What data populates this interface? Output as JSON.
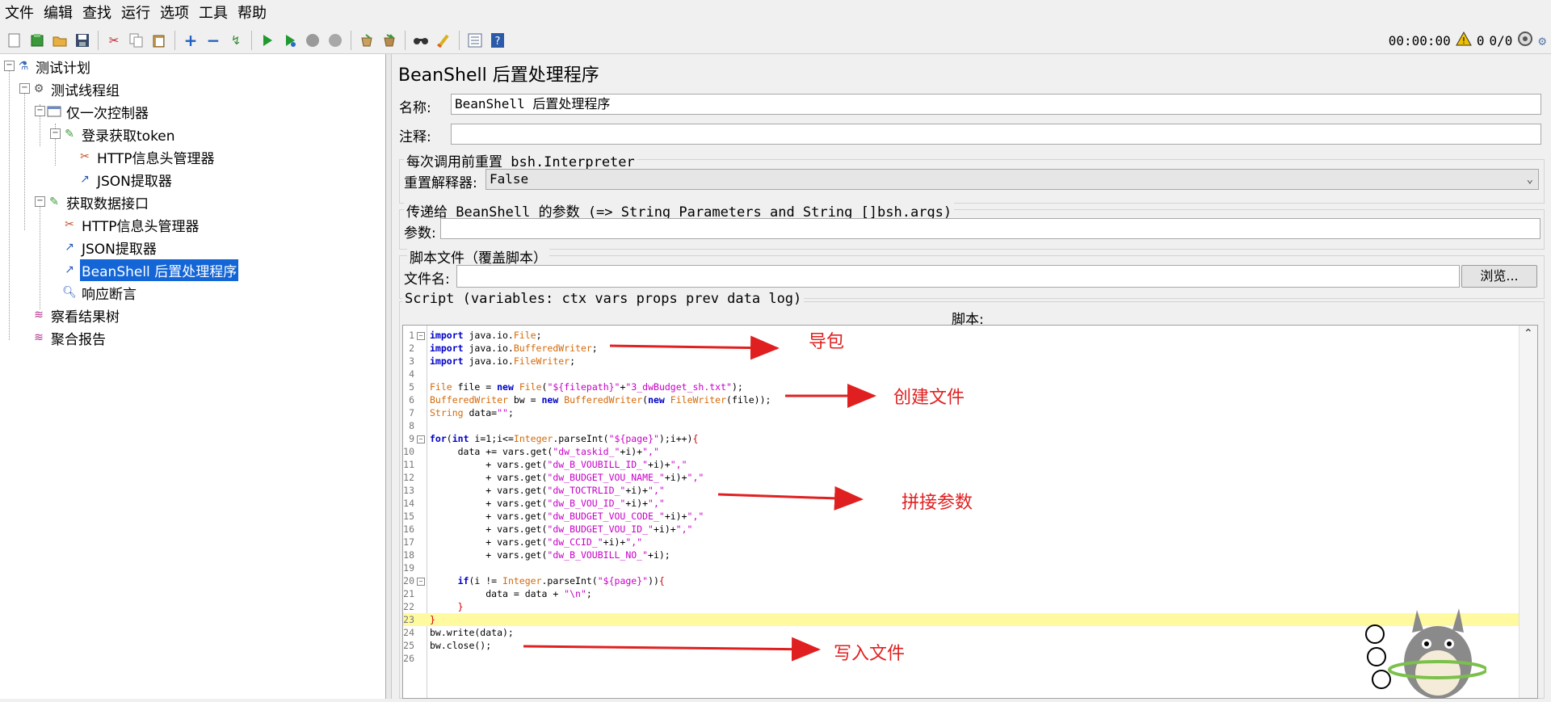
{
  "menu": [
    "文件",
    "编辑",
    "查找",
    "运行",
    "选项",
    "工具",
    "帮助"
  ],
  "toolbar": {
    "icons": [
      "new-file-icon",
      "templates-icon",
      "open-folder-icon",
      "save-icon",
      "cut-icon",
      "copy-icon",
      "paste-icon",
      "expand-icon",
      "collapse-icon",
      "toggle-icon",
      "start-icon",
      "start-no-pause-icon",
      "stop-icon",
      "shutdown-icon",
      "clear-icon",
      "clear-all-icon",
      "search-icon",
      "reset-search-icon",
      "function-helper-icon",
      "help-icon"
    ],
    "timer": "00:00:00",
    "warning_count": "0",
    "threads": "0/0"
  },
  "tree": [
    {
      "label": "测试计划",
      "icon": "test-plan-icon"
    },
    {
      "label": "测试线程组",
      "icon": "thread-group-icon"
    },
    {
      "label": "仅一次控制器",
      "icon": "controller-icon"
    },
    {
      "label": "登录获取token",
      "icon": "sampler-icon"
    },
    {
      "label": "HTTP信息头管理器",
      "icon": "header-manager-icon"
    },
    {
      "label": "JSON提取器",
      "icon": "extractor-icon"
    },
    {
      "label": "获取数据接口",
      "icon": "sampler-icon"
    },
    {
      "label": "HTTP信息头管理器",
      "icon": "header-manager-icon"
    },
    {
      "label": "JSON提取器",
      "icon": "extractor-icon"
    },
    {
      "label": "BeanShell 后置处理程序",
      "icon": "postprocessor-icon"
    },
    {
      "label": "响应断言",
      "icon": "assertion-icon"
    },
    {
      "label": "察看结果树",
      "icon": "listener-icon"
    },
    {
      "label": "聚合报告",
      "icon": "listener-icon"
    }
  ],
  "panel": {
    "title": "BeanShell 后置处理程序",
    "name_label": "名称:",
    "name_value": "BeanShell 后置处理程序",
    "comment_label": "注释:",
    "comment_value": "",
    "reset_group_title": "每次调用前重置 bsh.Interpreter",
    "reset_label": "重置解释器:",
    "reset_value": "False",
    "params_group_title": "传递给 BeanShell 的参数 (=> String Parameters and String []bsh.args)",
    "params_label": "参数:",
    "params_value": "",
    "file_group_title": "脚本文件（覆盖脚本）",
    "file_label": "文件名:",
    "file_value": "",
    "browse_label": "浏览...",
    "script_group_title": "Script (variables: ctx vars props prev data log)",
    "script_label": "脚本:"
  },
  "code": [
    "import java.io.File;",
    "import java.io.BufferedWriter;",
    "import java.io.FileWriter;",
    "",
    "File file = new File(\"${filepath}\"+\"3_dwBudget_sh.txt\");",
    "BufferedWriter bw = new BufferedWriter(new FileWriter(file));",
    "String data=\"\";",
    "",
    "for(int i=1;i<=Integer.parseInt(\"${page}\");i++){",
    "     data += vars.get(\"dw_taskid_\"+i)+\",\"",
    "          + vars.get(\"dw_B_VOUBILL_ID_\"+i)+\",\"",
    "          + vars.get(\"dw_BUDGET_VOU_NAME_\"+i)+\",\"",
    "          + vars.get(\"dw_TOCTRLID_\"+i)+\",\"",
    "          + vars.get(\"dw_B_VOU_ID_\"+i)+\",\"",
    "          + vars.get(\"dw_BUDGET_VOU_CODE_\"+i)+\",\"",
    "          + vars.get(\"dw_BUDGET_VOU_ID_\"+i)+\",\"",
    "          + vars.get(\"dw_CCID_\"+i)+\",\"",
    "          + vars.get(\"dw_B_VOUBILL_NO_\"+i);",
    "",
    "     if(i != Integer.parseInt(\"${page}\")){",
    "          data = data + \"\\n\";",
    "     }",
    "}",
    "bw.write(data);",
    "bw.close();",
    ""
  ],
  "annotations": {
    "import": "导包",
    "create_file": "创建文件",
    "concat": "拼接参数",
    "write": "写入文件"
  },
  "accent_color": "#1466d6",
  "annotation_color": "#e02020"
}
